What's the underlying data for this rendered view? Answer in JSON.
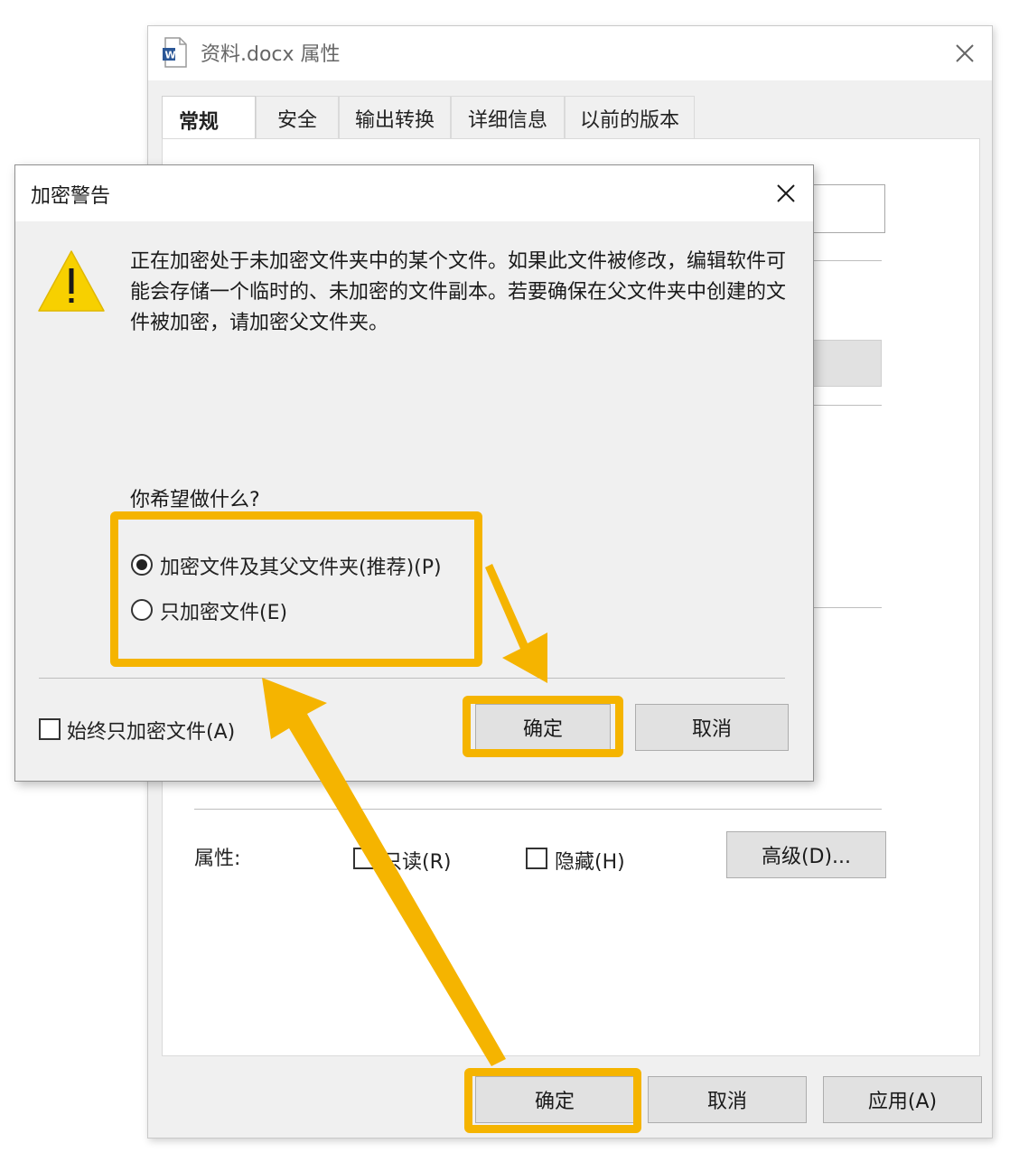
{
  "properties_window": {
    "title": "资料.docx 属性",
    "tabs": [
      {
        "label": "常规",
        "active": true
      },
      {
        "label": "安全",
        "active": false
      },
      {
        "label": "输出转换",
        "active": false
      },
      {
        "label": "详细信息",
        "active": false
      },
      {
        "label": "以前的版本",
        "active": false
      }
    ],
    "attributes_label": "属性:",
    "readonly_label": "只读(R)",
    "hidden_label": "隐藏(H)",
    "advanced_label": "高级(D)...",
    "ok_label": "确定",
    "cancel_label": "取消",
    "apply_label": "应用(A)"
  },
  "warning_dialog": {
    "title": "加密警告",
    "message": "正在加密处于未加密文件夹中的某个文件。如果此文件被修改，编辑软件可能会存储一个临时的、未加密的文件副本。若要确保在父文件夹中创建的文件被加密，请加密父文件夹。",
    "question": "你希望做什么?",
    "options": [
      {
        "label": "加密文件及其父文件夹(推荐)(P)",
        "selected": true
      },
      {
        "label": "只加密文件(E)",
        "selected": false
      }
    ],
    "always_label": "始终只加密文件(A)",
    "always_checked": false,
    "ok_label": "确定",
    "cancel_label": "取消"
  },
  "colors": {
    "highlight": "#f5b400",
    "warning_icon": "#f7d000",
    "window_bg": "#f0f0f0"
  },
  "icons": [
    "word-document-icon",
    "close-icon",
    "warning-icon",
    "arrow-icon"
  ]
}
